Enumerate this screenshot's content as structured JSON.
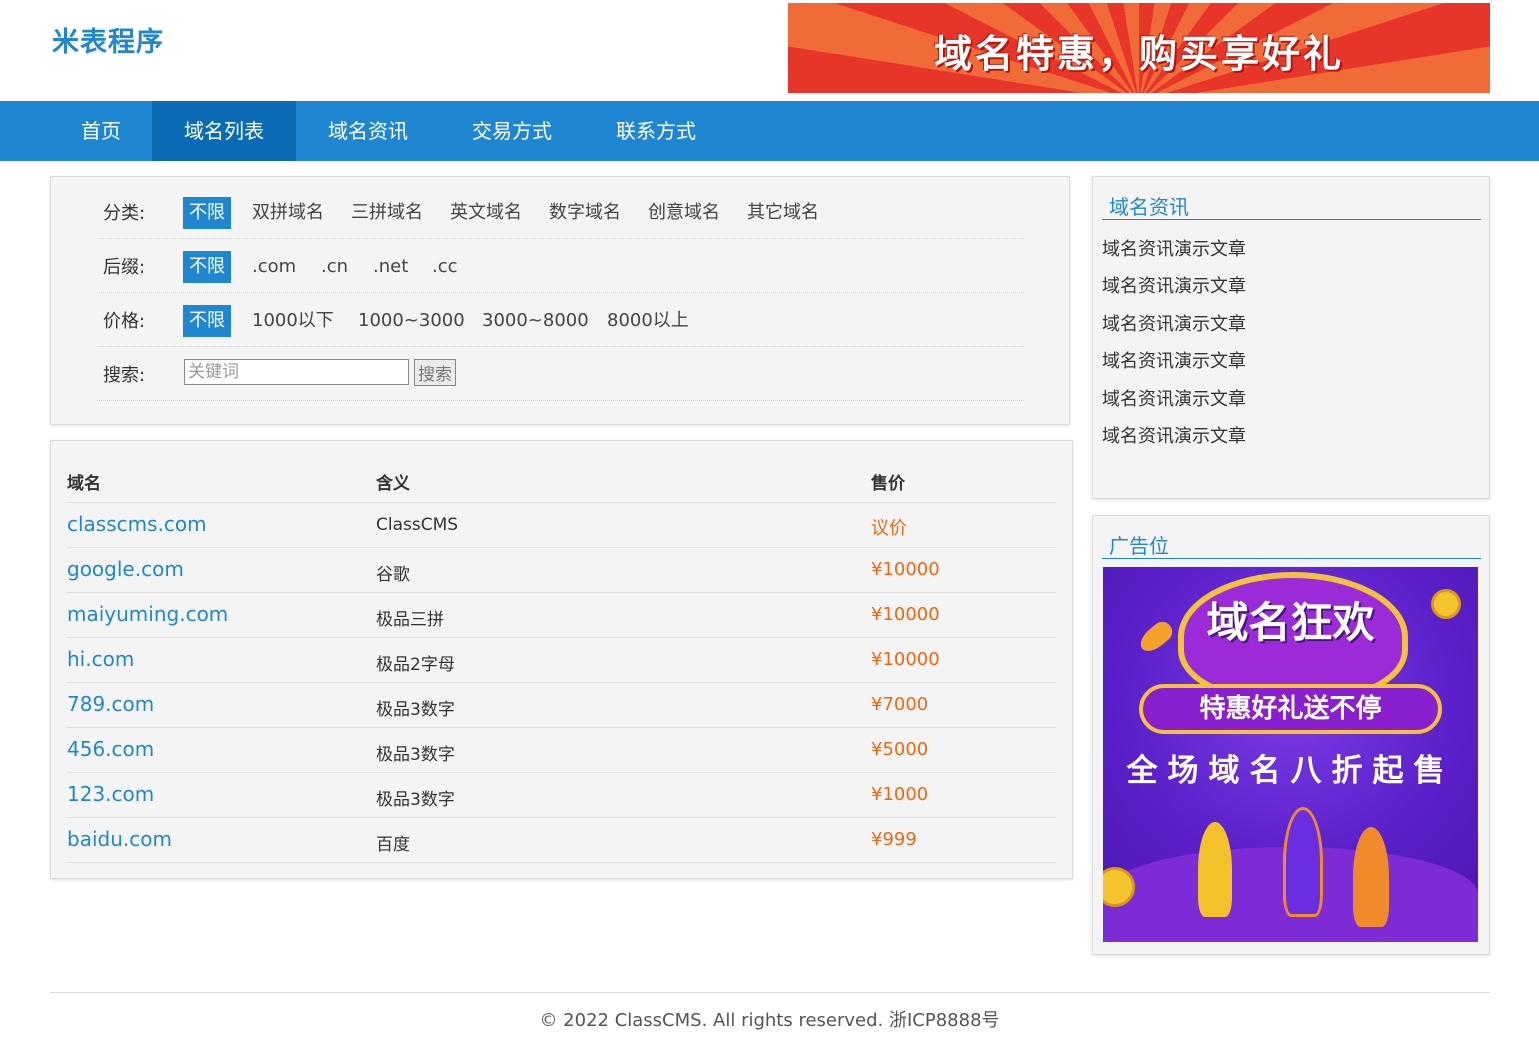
{
  "header": {
    "logo": "米表程序",
    "banner_text": "域名特惠，购买享好礼"
  },
  "nav": {
    "items": [
      {
        "label": "首页",
        "active": false
      },
      {
        "label": "域名列表",
        "active": true
      },
      {
        "label": "域名资讯",
        "active": false
      },
      {
        "label": "交易方式",
        "active": false
      },
      {
        "label": "联系方式",
        "active": false
      }
    ]
  },
  "filters": {
    "category": {
      "label": "分类:",
      "options": [
        "不限",
        "双拼域名",
        "三拼域名",
        "英文域名",
        "数字域名",
        "创意域名",
        "其它域名"
      ],
      "selected": "不限"
    },
    "suffix": {
      "label": "后缀:",
      "options": [
        "不限",
        ".com",
        ".cn",
        ".net",
        ".cc"
      ],
      "selected": "不限"
    },
    "price": {
      "label": "价格:",
      "options": [
        "不限",
        "1000以下",
        "1000~3000",
        "3000~8000",
        "8000以上"
      ],
      "selected": "不限"
    },
    "search": {
      "label": "搜索:",
      "placeholder": "关键词",
      "value": "",
      "button_label": "搜索"
    }
  },
  "table": {
    "headers": {
      "domain": "域名",
      "meaning": "含义",
      "price": "售价"
    },
    "rows": [
      {
        "domain": "classcms.com",
        "meaning": "ClassCMS",
        "price": "议价"
      },
      {
        "domain": "google.com",
        "meaning": "谷歌",
        "price": "¥10000"
      },
      {
        "domain": "maiyuming.com",
        "meaning": "极品三拼",
        "price": "¥10000"
      },
      {
        "domain": "hi.com",
        "meaning": "极品2字母",
        "price": "¥10000"
      },
      {
        "domain": "789.com",
        "meaning": "极品3数字",
        "price": "¥7000"
      },
      {
        "domain": "456.com",
        "meaning": "极品3数字",
        "price": "¥5000"
      },
      {
        "domain": "123.com",
        "meaning": "极品3数字",
        "price": "¥1000"
      },
      {
        "domain": "baidu.com",
        "meaning": "百度",
        "price": "¥999"
      }
    ]
  },
  "sidebar": {
    "news": {
      "title": "域名资讯",
      "items": [
        "域名资讯演示文章",
        "域名资讯演示文章",
        "域名资讯演示文章",
        "域名资讯演示文章",
        "域名资讯演示文章",
        "域名资讯演示文章"
      ]
    },
    "ad": {
      "title": "广告位",
      "image_title": "域名狂欢",
      "image_pill": "特惠好礼送不停",
      "image_sub": "全场域名八折起售"
    }
  },
  "footer": {
    "text": "© 2022 ClassCMS. All rights reserved. 浙ICP8888号"
  },
  "colors": {
    "brand": "#1f87d1",
    "nav_active": "#0b6cb5",
    "price": "#f0670e"
  }
}
